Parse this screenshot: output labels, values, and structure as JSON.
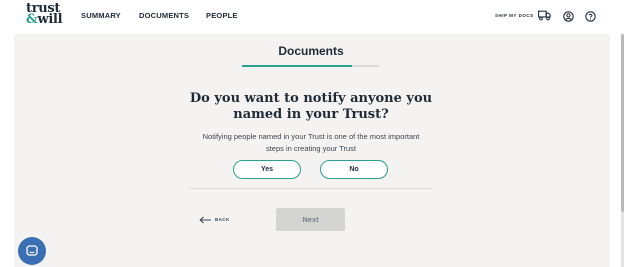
{
  "header": {
    "logo_line1": "trust",
    "logo_amp": "&",
    "logo_line2": "will",
    "nav": [
      "SUMMARY",
      "DOCUMENTS",
      "PEOPLE"
    ],
    "ship_label": "SHIP MY DOCS",
    "icons": [
      "truck-icon",
      "account-icon",
      "help-icon"
    ]
  },
  "main": {
    "section_title": "Documents",
    "progress": 0.8,
    "question_line1": "Do you want to notify anyone you",
    "question_line2": "named in your Trust?",
    "description_line1": "Notifying people named in your Trust is one of the most important",
    "description_line2": "steps in creating your Trust",
    "choices": [
      "Yes",
      "No"
    ],
    "back_label": "BACK",
    "next_label": "Next"
  },
  "chat_icon": "chat-icon",
  "colors": {
    "brand_navy": "#1f2a38",
    "accent_teal": "#2aa18e",
    "panel_bg": "#f4f3f1",
    "button_disabled": "#d4d4d2",
    "chat_blue": "#3b6fb4"
  }
}
